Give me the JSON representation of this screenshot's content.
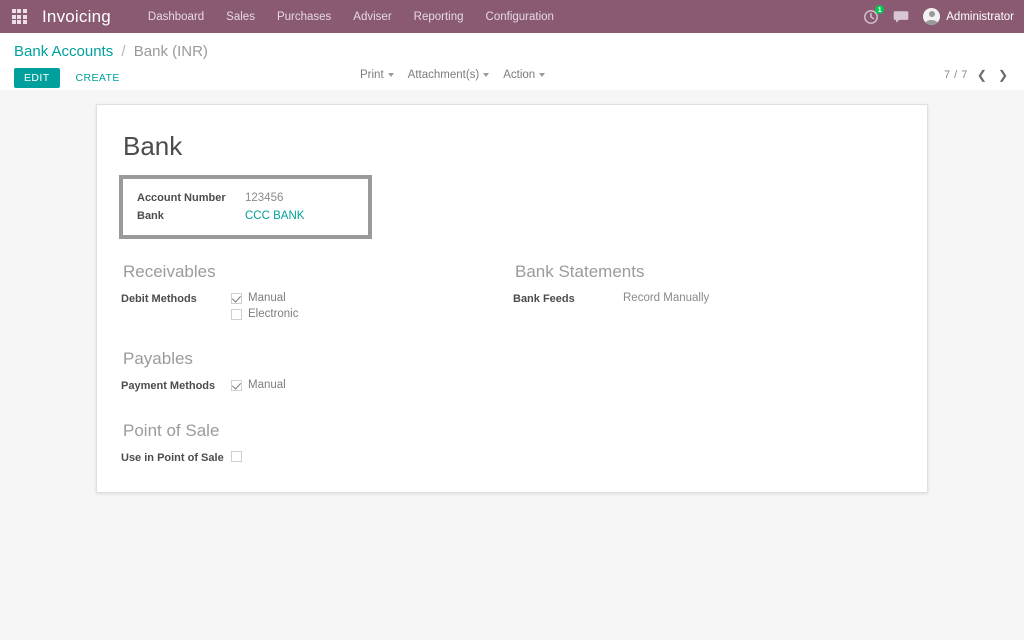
{
  "navbar": {
    "apps_icon": "apps-grid-icon",
    "brand": "Invoicing",
    "menu": [
      {
        "label": "Dashboard"
      },
      {
        "label": "Sales"
      },
      {
        "label": "Purchases"
      },
      {
        "label": "Adviser"
      },
      {
        "label": "Reporting"
      },
      {
        "label": "Configuration"
      }
    ],
    "activity_icon": "clock-activity-icon",
    "activity_count": "1",
    "messages_icon": "chat-bubble-icon",
    "avatar_icon": "user-avatar-icon",
    "user_name": "Administrator",
    "bg_color": "#8a5a72",
    "badge_color": "#00c853"
  },
  "control_panel": {
    "breadcrumb": {
      "parent": "Bank Accounts",
      "separator": "/",
      "current": "Bank (INR)"
    },
    "edit_label": "EDIT",
    "create_label": "CREATE",
    "accent_color": "#00a09d",
    "dropdowns": [
      {
        "label": "Print"
      },
      {
        "label": "Attachment(s)"
      },
      {
        "label": "Action"
      }
    ],
    "pager": {
      "value": "7 / 7",
      "prev_icon": "chevron-left-icon",
      "next_icon": "chevron-right-icon"
    }
  },
  "form": {
    "title": "Bank",
    "highlight": {
      "border_color": "#9a9a9a",
      "fields": [
        {
          "label": "Account Number",
          "value": "123456",
          "is_link": false
        },
        {
          "label": "Bank",
          "value": "CCC BANK",
          "is_link": true
        }
      ]
    },
    "left_groups": [
      {
        "title": "Receivables",
        "field_label": "Debit Methods",
        "options": [
          {
            "label": "Manual",
            "checked": true
          },
          {
            "label": "Electronic",
            "checked": false
          }
        ]
      },
      {
        "title": "Payables",
        "field_label": "Payment Methods",
        "options": [
          {
            "label": "Manual",
            "checked": true
          }
        ]
      },
      {
        "title": "Point of Sale",
        "field_label": "Use in Point of Sale",
        "options": [
          {
            "label": "",
            "checked": false
          }
        ]
      }
    ],
    "right_groups": [
      {
        "title": "Bank Statements",
        "field_label": "Bank Feeds",
        "value": "Record Manually"
      }
    ]
  }
}
